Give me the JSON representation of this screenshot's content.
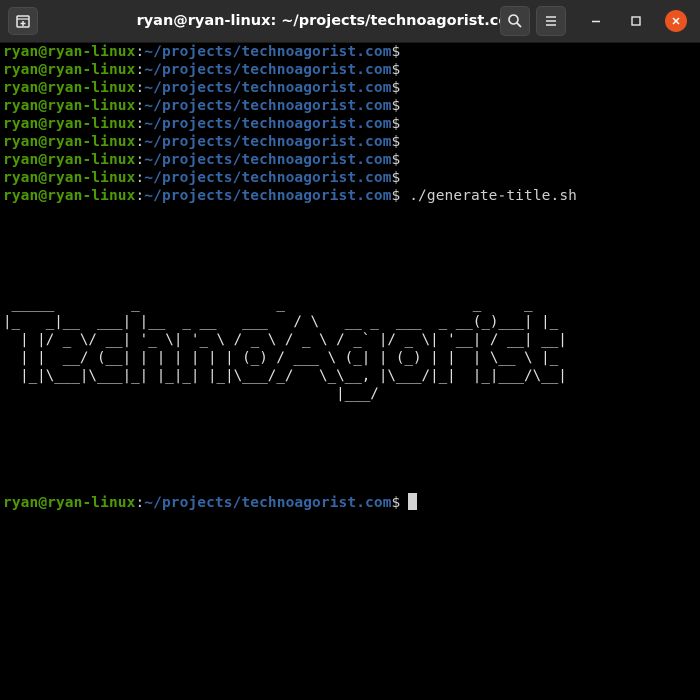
{
  "window": {
    "title": "ryan@ryan-linux: ~/projects/technoagorist.com",
    "icons": {
      "new_tab": "new-tab-icon",
      "search": "search-icon",
      "menu": "hamburger-menu-icon",
      "minimize": "minimize-icon",
      "maximize": "maximize-icon",
      "close": "close-icon"
    }
  },
  "terminal": {
    "user_host": "ryan@ryan-linux",
    "separator": ":",
    "path": "~/projects/technoagorist.com",
    "prompt_symbol": "$",
    "empty_prompt_count": 8,
    "command": "./generate-title.sh",
    "ascii_art": " _____         _                _                      _     _   \n|_   _|__  ___| |__  _ __   ___   / \\   __ _  ___  _ __(_)___| |_ \n  | |/ _ \\/ __| '_ \\| '_ \\ / _ \\ / _ \\ / _` |/ _ \\| '__| / __| __|\n  | |  __/ (__| | | | | | | (_) / ___ \\ (_| | (_) | |  | \\__ \\ |_ \n  |_|\\___|\\___|_| |_|_| |_|\\___/_/   \\_\\__, |\\___/|_|  |_|___/\\__|\n                                       |___/                      ",
    "colors": {
      "user_host": "#4e9a06",
      "path": "#3465a4",
      "text": "#d0d0d0",
      "background": "#000000",
      "close_button": "#e95420"
    }
  }
}
